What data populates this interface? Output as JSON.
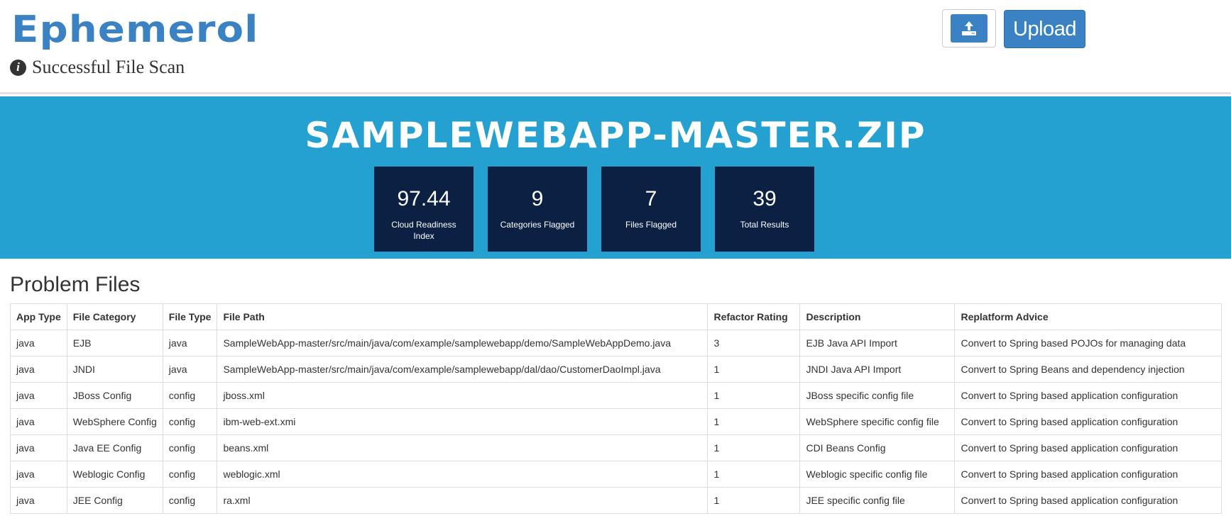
{
  "app": {
    "logo": "Ephemerol"
  },
  "status": {
    "text": "Successful File Scan",
    "icon": "info-circle-icon"
  },
  "toolbar": {
    "upload_icon": "upload-icon",
    "upload_label": "Upload"
  },
  "banner": {
    "title": "SAMPLEWEBAPP-MASTER.ZIP",
    "stats": [
      {
        "value": "97.44",
        "label": "Cloud Readiness Index"
      },
      {
        "value": "9",
        "label": "Categories Flagged"
      },
      {
        "value": "7",
        "label": "Files Flagged"
      },
      {
        "value": "39",
        "label": "Total Results"
      }
    ]
  },
  "problems": {
    "title": "Problem Files",
    "columns": [
      "App Type",
      "File Category",
      "File Type",
      "File Path",
      "Refactor Rating",
      "Description",
      "Replatform Advice"
    ],
    "rows": [
      [
        "java",
        "EJB",
        "java",
        "SampleWebApp-master/src/main/java/com/example/samplewebapp/demo/SampleWebAppDemo.java",
        "3",
        "EJB Java API Import",
        "Convert to Spring based POJOs for managing data"
      ],
      [
        "java",
        "JNDI",
        "java",
        "SampleWebApp-master/src/main/java/com/example/samplewebapp/dal/dao/CustomerDaoImpl.java",
        "1",
        "JNDI Java API Import",
        "Convert to Spring Beans and dependency injection"
      ],
      [
        "java",
        "JBoss Config",
        "config",
        "jboss.xml",
        "1",
        "JBoss specific config file",
        "Convert to Spring based application configuration"
      ],
      [
        "java",
        "WebSphere Config",
        "config",
        "ibm-web-ext.xmi",
        "1",
        "WebSphere specific config file",
        "Convert to Spring based application configuration"
      ],
      [
        "java",
        "Java EE Config",
        "config",
        "beans.xml",
        "1",
        "CDI Beans Config",
        "Convert to Spring based application configuration"
      ],
      [
        "java",
        "Weblogic Config",
        "config",
        "weblogic.xml",
        "1",
        "Weblogic specific config file",
        "Convert to Spring based application configuration"
      ],
      [
        "java",
        "JEE Config",
        "config",
        "ra.xml",
        "1",
        "JEE specific config file",
        "Convert to Spring based application configuration"
      ]
    ]
  },
  "colors": {
    "brand": "#3a82c4",
    "banner": "#24a1d0",
    "stat_bg": "#0c2044"
  }
}
